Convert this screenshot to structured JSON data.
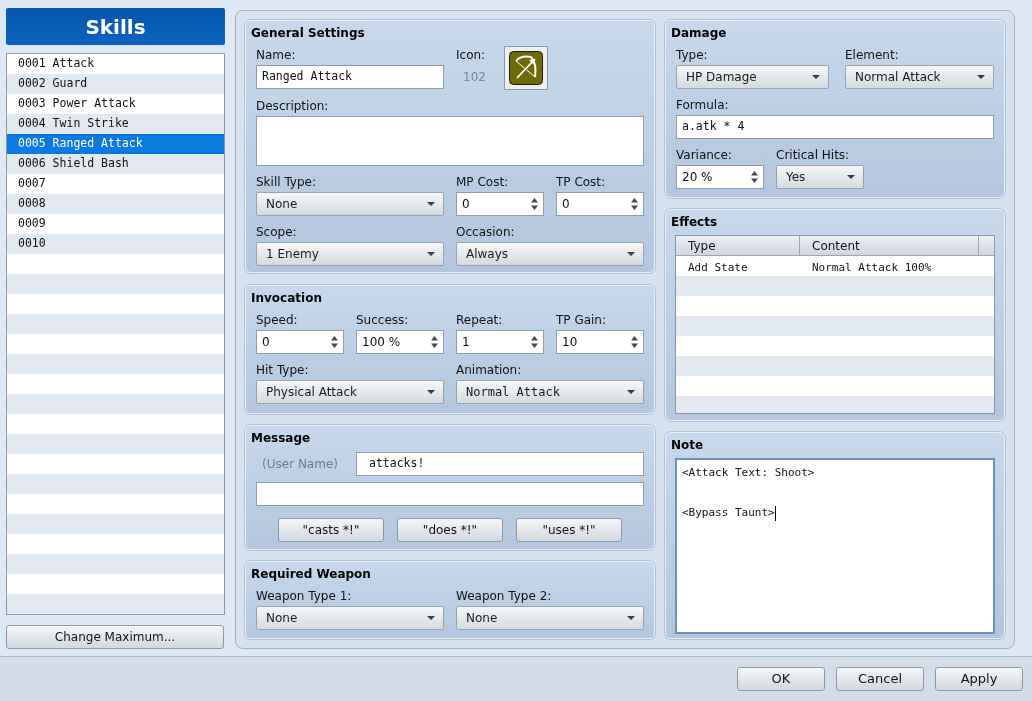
{
  "sidebar": {
    "title": "Skills",
    "items": [
      {
        "label": "0001 Attack",
        "selected": false
      },
      {
        "label": "0002 Guard",
        "selected": false
      },
      {
        "label": "0003 Power Attack",
        "selected": false
      },
      {
        "label": "0004 Twin Strike",
        "selected": false
      },
      {
        "label": "0005 Ranged Attack",
        "selected": true
      },
      {
        "label": "0006 Shield Bash",
        "selected": false
      },
      {
        "label": "0007",
        "selected": false
      },
      {
        "label": "0008",
        "selected": false
      },
      {
        "label": "0009",
        "selected": false
      },
      {
        "label": "0010",
        "selected": false
      }
    ],
    "change_maximum_button": "Change Maximum..."
  },
  "general_settings": {
    "title": "General Settings",
    "name": {
      "label": "Name:",
      "kind": "text",
      "value": "Ranged Attack"
    },
    "icon": {
      "label": "Icon:",
      "index": "102"
    },
    "description": {
      "label": "Description:",
      "kind": "textarea"
    },
    "skill_type": {
      "label": "Skill Type:",
      "kind": "select",
      "value": "None"
    },
    "mp_cost": {
      "label": "MP Cost:",
      "kind": "spin",
      "value": "0"
    },
    "tp_cost": {
      "label": "TP Cost:",
      "kind": "spin",
      "value": "0"
    },
    "scope": {
      "label": "Scope:",
      "kind": "select",
      "value": "1 Enemy"
    },
    "occasion": {
      "label": "Occasion:",
      "kind": "select",
      "value": "Always"
    }
  },
  "invocation": {
    "title": "Invocation",
    "speed": {
      "label": "Speed:",
      "kind": "spin",
      "value": "0"
    },
    "success": {
      "label": "Success:",
      "kind": "spin",
      "value": "100 %"
    },
    "repeat": {
      "label": "Repeat:",
      "kind": "spin",
      "value": "1"
    },
    "tp_gain": {
      "label": "TP Gain:",
      "kind": "spin",
      "value": "10"
    },
    "hit_type": {
      "label": "Hit Type:",
      "kind": "select",
      "value": "Physical Attack"
    },
    "animation": {
      "label": "Animation:",
      "kind": "select",
      "value": "Normal Attack"
    }
  },
  "message": {
    "title": "Message",
    "user_name_label": "(User Name)",
    "line_1": {
      "kind": "text",
      "value": "attacks!"
    },
    "line_2": {
      "kind": "text"
    },
    "buttons": [
      "\"casts *!\"",
      "\"does *!\"",
      "\"uses *!\""
    ]
  },
  "required_weapon": {
    "title": "Required Weapon",
    "weapon_type_1": {
      "label": "Weapon Type 1:",
      "kind": "select",
      "value": "None"
    },
    "weapon_type_2": {
      "label": "Weapon Type 2:",
      "kind": "select",
      "value": "None"
    }
  },
  "damage": {
    "title": "Damage",
    "type": {
      "label": "Type:",
      "kind": "select",
      "value": "HP Damage"
    },
    "element": {
      "label": "Element:",
      "kind": "select",
      "value": "Normal Attack"
    },
    "formula": {
      "label": "Formula:",
      "kind": "text",
      "value": "a.atk * 4"
    },
    "variance": {
      "label": "Variance:",
      "kind": "spin",
      "value": "20 %"
    },
    "critical_hits": {
      "label": "Critical Hits:",
      "kind": "select",
      "value": "Yes"
    }
  },
  "effects": {
    "title": "Effects",
    "columns": [
      "Type",
      "Content"
    ],
    "rows": [
      {
        "type": "Add State",
        "content": "Normal Attack 100%"
      }
    ]
  },
  "note": {
    "title": "Note",
    "value": "<Attack Text: Shoot>\n\n<Bypass Taunt>"
  },
  "buttons": [
    "OK",
    "Cancel",
    "Apply"
  ]
}
